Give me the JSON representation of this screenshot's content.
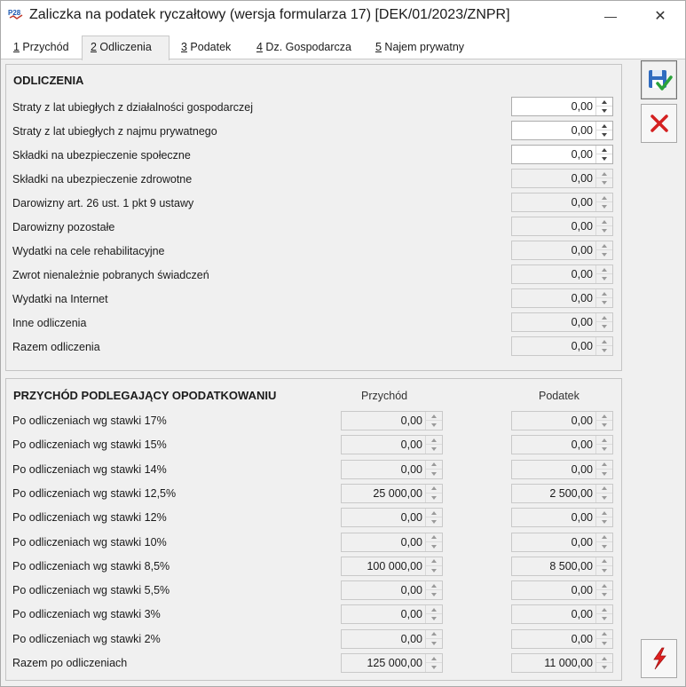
{
  "window": {
    "title": "Zaliczka na podatek ryczałtowy (wersja formularza 17) [DEK/01/2023/ZNPR]",
    "app_icon_text": "P28",
    "minimize_glyph": "—",
    "close_glyph": "✕"
  },
  "tabs": [
    {
      "key": "1",
      "label": " Przychód"
    },
    {
      "key": "2",
      "label": " Odliczenia"
    },
    {
      "key": "3",
      "label": " Podatek"
    },
    {
      "key": "4",
      "label": " Dz. Gospodarcza"
    },
    {
      "key": "5",
      "label": " Najem prywatny"
    }
  ],
  "active_tab": "2",
  "toolbar": {
    "save_icon": "save-check-icon",
    "cancel_icon": "red-x-icon",
    "action_icon": "lightning-icon"
  },
  "odliczenia": {
    "title": "ODLICZENIA",
    "rows": [
      {
        "label": "Straty z lat ubiegłych z działalności gospodarczej",
        "value": "0,00",
        "editable": true
      },
      {
        "label": "Straty z lat ubiegłych z najmu prywatnego",
        "value": "0,00",
        "editable": true
      },
      {
        "label": "Składki na ubezpieczenie społeczne",
        "value": "0,00",
        "editable": true
      },
      {
        "label": "Składki na ubezpieczenie zdrowotne",
        "value": "0,00",
        "editable": false
      },
      {
        "label": "Darowizny art. 26 ust. 1 pkt 9 ustawy",
        "value": "0,00",
        "editable": false
      },
      {
        "label": "Darowizny pozostałe",
        "value": "0,00",
        "editable": false
      },
      {
        "label": "Wydatki na cele rehabilitacyjne",
        "value": "0,00",
        "editable": false
      },
      {
        "label": "Zwrot nienależnie pobranych świadczeń",
        "value": "0,00",
        "editable": false
      },
      {
        "label": "Wydatki na Internet",
        "value": "0,00",
        "editable": false
      },
      {
        "label": "Inne odliczenia",
        "value": "0,00",
        "editable": false
      },
      {
        "label": "Razem odliczenia",
        "value": "0,00",
        "editable": false
      }
    ]
  },
  "przychod": {
    "title": "PRZYCHÓD PODLEGAJĄCY OPODATKOWANIU",
    "col_przychod": "Przychód",
    "col_podatek": "Podatek",
    "rows": [
      {
        "label": "Po odliczeniach wg stawki 17%",
        "przychod": "0,00",
        "podatek": "0,00"
      },
      {
        "label": "Po odliczeniach wg stawki 15%",
        "przychod": "0,00",
        "podatek": "0,00"
      },
      {
        "label": "Po odliczeniach wg stawki 14%",
        "przychod": "0,00",
        "podatek": "0,00"
      },
      {
        "label": "Po odliczeniach wg stawki 12,5%",
        "przychod": "25 000,00",
        "podatek": "2 500,00"
      },
      {
        "label": "Po odliczeniach wg stawki 12%",
        "przychod": "0,00",
        "podatek": "0,00"
      },
      {
        "label": "Po odliczeniach wg stawki 10%",
        "przychod": "0,00",
        "podatek": "0,00"
      },
      {
        "label": "Po odliczeniach wg stawki 8,5%",
        "przychod": "100 000,00",
        "podatek": "8 500,00"
      },
      {
        "label": "Po odliczeniach wg stawki 5,5%",
        "przychod": "0,00",
        "podatek": "0,00"
      },
      {
        "label": "Po odliczeniach wg stawki 3%",
        "przychod": "0,00",
        "podatek": "0,00"
      },
      {
        "label": "Po odliczeniach wg stawki 2%",
        "przychod": "0,00",
        "podatek": "0,00"
      },
      {
        "label": "Razem po odliczeniach",
        "przychod": "125 000,00",
        "podatek": "11 000,00"
      }
    ]
  }
}
